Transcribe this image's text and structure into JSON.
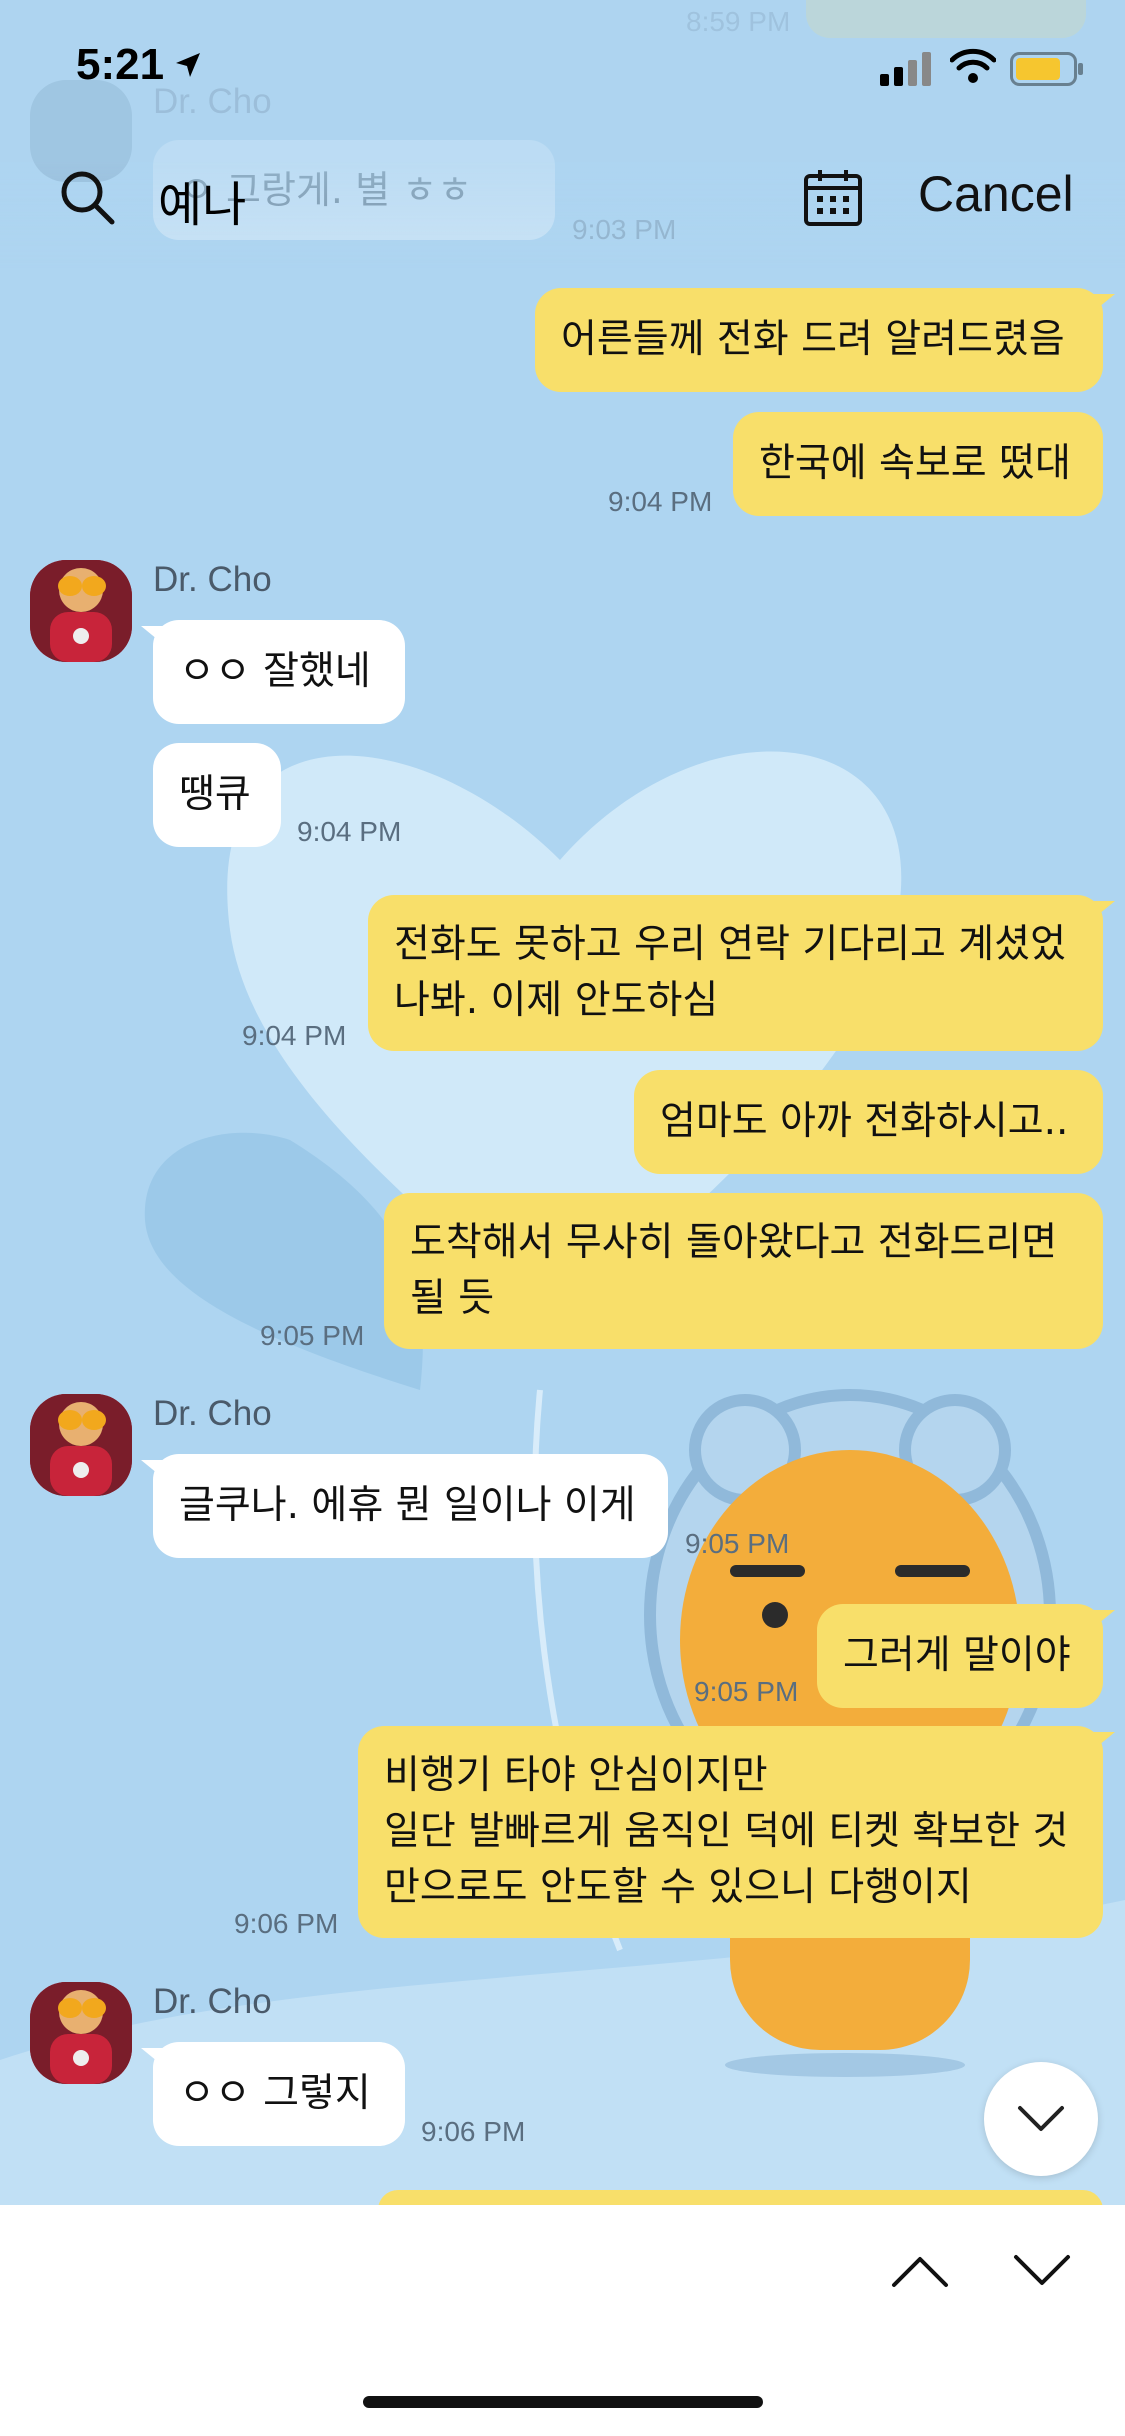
{
  "status_bar": {
    "time": "5:21"
  },
  "search": {
    "query": "예나",
    "cancel_label": "Cancel"
  },
  "faded": {
    "time_top": "8:59 PM",
    "sender": "Dr. Cho",
    "message": "ㅇ 그랑게. 별 ㅎㅎ",
    "time": "9:03 PM"
  },
  "messages": {
    "m1": "어른들께 전화 드려 알려드렸음",
    "m2": "한국에 속보로 떴대",
    "t2": "9:04 PM",
    "sender1": "Dr. Cho",
    "m3": "ㅇㅇ 잘했네",
    "m4": "땡큐",
    "t4": "9:04 PM",
    "m5": "전화도 못하고 우리 연락 기다리고 계셨었\n나봐. 이제 안도하심",
    "t5": "9:04 PM",
    "m6": "엄마도 아까 전화하시고..",
    "m7": "도착해서 무사히 돌아왔다고 전화드리면\n될 듯",
    "t7": "9:05 PM",
    "sender2": "Dr. Cho",
    "m8": "글쿠나. 에휴 뭔 일이나 이게",
    "t8": "9:05 PM",
    "m9": "그러게 말이야",
    "t9": "9:05 PM",
    "m10": "비행기 타야 안심이지만\n일단 발빠르게 움직인 덕에 티켓 확보한 것\n만으로도 안도할 수 있으니 다행이지",
    "t10": "9:06 PM",
    "sender3": "Dr. Cho",
    "m11": "ㅇㅇ 그렇지",
    "t11": "9:06 PM"
  },
  "colors": {
    "chat_background": "#aed5f1",
    "my_bubble": "#f8df6a",
    "their_bubble": "#ffffff"
  }
}
